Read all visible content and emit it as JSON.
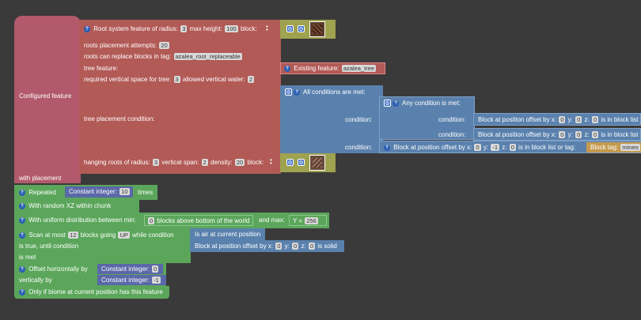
{
  "configured_feature": {
    "label": "Configured feature",
    "with_placement": "with placement"
  },
  "root_system": {
    "prefix": "Root system feature of radius:",
    "radius": "3",
    "max_height_label": "max height:",
    "max_height": "100",
    "block_label": "block:",
    "attempts_label": "roots placement attempts:",
    "attempts": "20",
    "replace_label": "roots can replace blocks in tag:",
    "replace_tag": "azalea_root_replaceable",
    "tree_feature_label": "tree feature:",
    "vertical_space_label": "required vertical space for tree:",
    "vertical_space": "3",
    "water_label": "allowed vertical water:",
    "water": "2",
    "tree_condition_label": "tree placement condition:",
    "hanging_label": "hanging roots of radius:",
    "hanging_radius": "3",
    "vertical_span_label": "vertical span:",
    "vertical_span": "2",
    "density_label": "density:",
    "density": "20",
    "hanging_block_label": "block:"
  },
  "existing_feature": {
    "label": "Existing feature:",
    "value": "azalea_tree"
  },
  "all_conditions": {
    "label": "All conditions are met:",
    "condition_label": "condition:"
  },
  "any_condition": {
    "label": "Any condition is met:",
    "condition_label": "condition:"
  },
  "offset_blocks": [
    {
      "prefix": "Block at position offset by x:",
      "x": "0",
      "y_label": "y:",
      "y": "0",
      "z_label": "z:",
      "z": "0",
      "suffix": "is in block list"
    },
    {
      "prefix": "Block at position offset by x:",
      "x": "0",
      "y_label": "y:",
      "y": "0",
      "z_label": "z:",
      "z": "0",
      "suffix": "is in block list"
    },
    {
      "prefix": "Block at position offset by x:",
      "x": "0",
      "y_label": "y:",
      "y": "-1",
      "z_label": "z:",
      "z": "0",
      "suffix": "is in block list or tag:"
    }
  ],
  "block_tag": {
    "label": "Block tag:",
    "value": "mineo"
  },
  "placements": {
    "repeated": {
      "label": "Repeated",
      "const_label": "Constant integer:",
      "const_value": "10",
      "suffix": "times"
    },
    "random_xz": "With random XZ within chunk",
    "uniform": {
      "label": "With uniform distribution between min:",
      "min_value": "0",
      "min_suffix": "blocks above bottom of the world",
      "max_label": "and max:",
      "y_label": "Y =",
      "y_value": "256"
    },
    "scan": {
      "label": "Scan at most",
      "count": "12",
      "going": "blocks going",
      "direction": "UP",
      "while": "while condition",
      "line2": "is true, until condition",
      "line3": "is met",
      "air": "Is air at current position",
      "solid_prefix": "Block at position offset by x:",
      "sx": "0",
      "sy_label": "y:",
      "sy": "0",
      "sz_label": "z:",
      "sz": "0",
      "solid_suffix": "is solid"
    },
    "offset": {
      "label": "Offset horizontally by",
      "vert": "vertically by",
      "const_label": "Constant integer:",
      "h_value": "0",
      "v_value": "-1"
    },
    "biome": "Only if biome at current position has this feature"
  },
  "colors": {
    "configured": "#b25a6c",
    "root_feature": "#b25a56",
    "block": "#9fa24f",
    "condition": "#5a81ad",
    "placement": "#5ba65b",
    "integer": "#5b68a8",
    "tag": "#c49a4f",
    "background": "#3a3a3a"
  },
  "icons": {
    "help": "help-icon",
    "gear": "gear-icon",
    "menu": "more-vertical-icon"
  }
}
